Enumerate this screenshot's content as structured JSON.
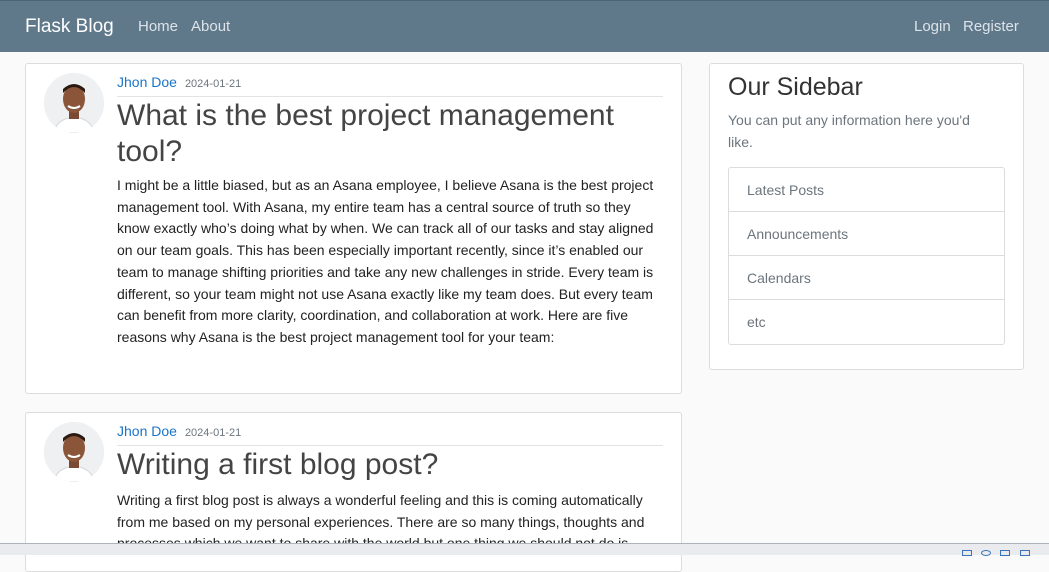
{
  "navbar": {
    "brand": "Flask Blog",
    "left_links": [
      "Home",
      "About"
    ],
    "right_links": [
      "Login",
      "Register"
    ]
  },
  "posts": [
    {
      "author": "Jhon Doe",
      "date": "2024-01-21",
      "title": "What is the best project management tool?",
      "content": "I might be a little biased, but as an Asana employee, I believe Asana is the best project management tool. With Asana, my entire team has a central source of truth so they know exactly who’s doing what by when. We can track all of our tasks and stay aligned on our team goals. This has been especially important recently, since it’s enabled our team to manage shifting priorities and take any new challenges in stride. Every team is different, so your team might not use Asana exactly like my team does. But every team can benefit from more clarity, coordination, and collaboration at work. Here are five reasons why Asana is the best project management tool for your team:"
    },
    {
      "author": "Jhon Doe",
      "date": "2024-01-21",
      "title": "Writing a first blog post?",
      "content": "Writing a first blog post is always a wonderful feeling and this is coming automatically from me based on my personal experiences. There are so many things, thoughts and processes which we want to share with the world but one thing we should not do is"
    }
  ],
  "sidebar": {
    "title": "Our Sidebar",
    "text": "You can put any information here you'd like.",
    "items": [
      "Latest Posts",
      "Announcements",
      "Calendars",
      "etc"
    ]
  },
  "icons": {
    "avatar": "profile-photo-icon",
    "tray": [
      "window-icon",
      "globe-icon",
      "folder-icon",
      "screen-icon"
    ]
  },
  "colors": {
    "navbar_bg": "#5f788a",
    "link": "#1a75c9",
    "muted": "#6c757d"
  }
}
